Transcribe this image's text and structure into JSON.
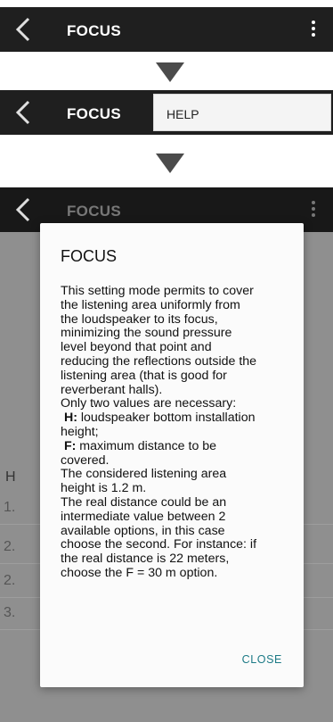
{
  "screen1": {
    "title": "FOCUS"
  },
  "screen2": {
    "title": "FOCUS",
    "menu_popup_item": "HELP"
  },
  "screen3": {
    "title": "FOCUS",
    "background_heading": "H",
    "background_items": [
      "1.",
      "2.",
      "2.",
      "3."
    ]
  },
  "dialog": {
    "title": "FOCUS",
    "lines": [
      " This setting mode permits to cover",
      "the listening area uniformly from",
      "the loudspeaker to its focus,",
      "minimizing the sound pressure",
      "level beyond that point and",
      "reducing the reflections outside the",
      "listening area (that is good for",
      "reverberant halls).",
      " Only two values are necessary:"
    ],
    "h_label": "H:",
    "h_line1": " loudspeaker bottom installation",
    "h_line2": "height;",
    "f_label": "F:",
    "f_line1": " maximum distance to be",
    "f_line2": "covered.",
    "lines2": [
      " The considered listening area",
      "height is 1.2 m.",
      " The real distance could be an",
      "intermediate value between 2",
      "available options, in this case",
      "choose the second. For instance: if",
      "the real distance is 22 meters,",
      "choose the F = 30 m option."
    ],
    "close_label": "CLOSE"
  },
  "colors": {
    "toolbar": "#1f1f1f",
    "accent": "#1c7a86",
    "scrim": "#8f8f8f",
    "arrow": "#4b4b4b"
  },
  "icons": [
    "chevron-left-icon",
    "overflow-menu-icon",
    "down-arrow-icon"
  ]
}
